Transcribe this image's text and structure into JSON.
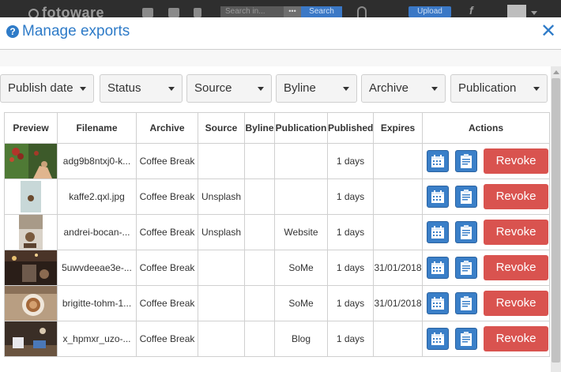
{
  "app_bar": {
    "logo": "fotoware",
    "search_placeholder": "Search in...",
    "search_dots": "•••",
    "search_button": "Search",
    "upload_button": "Upload",
    "fx_label": "f"
  },
  "dialog": {
    "title": "Manage exports",
    "help_icon": "?",
    "close_icon": "✕"
  },
  "filters": [
    {
      "label": "Publish date"
    },
    {
      "label": "Status"
    },
    {
      "label": "Source"
    },
    {
      "label": "Byline"
    },
    {
      "label": "Archive"
    },
    {
      "label": "Publication"
    }
  ],
  "table": {
    "headers": {
      "preview": "Preview",
      "filename": "Filename",
      "archive": "Archive",
      "source": "Source",
      "byline": "Byline",
      "publication": "Publication",
      "published": "Published",
      "expires": "Expires",
      "actions": "Actions"
    },
    "revoke_label": "Revoke",
    "rows": [
      {
        "filename": "adg9b8ntxj0-k...",
        "archive": "Coffee Break",
        "source": "",
        "byline": "",
        "publication": "",
        "published": "1 days",
        "expires": ""
      },
      {
        "filename": "kaffe2.qxl.jpg",
        "archive": "Coffee Break",
        "source": "Unsplash",
        "byline": "",
        "publication": "",
        "published": "1 days",
        "expires": ""
      },
      {
        "filename": "andrei-bocan-...",
        "archive": "Coffee Break",
        "source": "Unsplash",
        "byline": "",
        "publication": "Website",
        "published": "1 days",
        "expires": ""
      },
      {
        "filename": "5uwvdeeae3e-...",
        "archive": "Coffee Break",
        "source": "",
        "byline": "",
        "publication": "SoMe",
        "published": "1 days",
        "expires": "31/01/2018"
      },
      {
        "filename": "brigitte-tohm-1...",
        "archive": "Coffee Break",
        "source": "",
        "byline": "",
        "publication": "SoMe",
        "published": "1 days",
        "expires": "31/01/2018"
      },
      {
        "filename": "x_hpmxr_uzo-...",
        "archive": "Coffee Break",
        "source": "",
        "byline": "",
        "publication": "Blog",
        "published": "1 days",
        "expires": ""
      }
    ]
  },
  "colors": {
    "accent": "#2e7bc8",
    "revoke": "#d9534f",
    "action_icon": "#3a7fc8"
  },
  "icons": {
    "calendar": "calendar-icon",
    "clipboard": "clipboard-icon",
    "help": "question-circle-icon",
    "close": "close-icon"
  }
}
